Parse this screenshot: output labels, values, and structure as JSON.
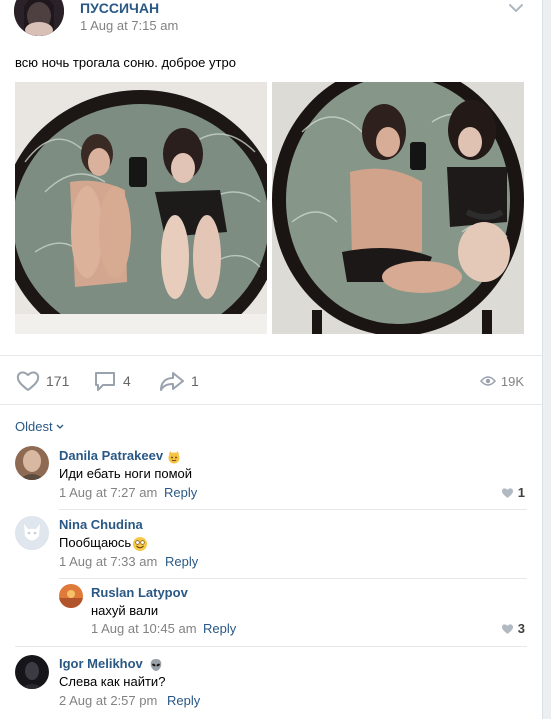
{
  "post": {
    "author": "ПУССИЧАН",
    "date": "1 Aug at 7:15 am",
    "text": "всю ночь трогала соню. доброе утро"
  },
  "actions": {
    "likes": "171",
    "comments": "4",
    "shares": "1",
    "views": "19K"
  },
  "comments_sort": "Oldest",
  "comments": [
    {
      "name": "Danila Patrakeev",
      "text": "Иди ебать ноги помой",
      "date": "1 Aug at 7:27 am",
      "reply": "Reply",
      "likes": "1",
      "badge": "cat-emoji"
    },
    {
      "name": "Nina Chudina",
      "text": "Пообщаюсь",
      "date": "1 Aug at 7:33 am",
      "reply": "Reply",
      "badge": "smile-emoji"
    },
    {
      "name": "Ruslan Latypov",
      "text": "нахуй вали",
      "date": "1 Aug at 10:45 am",
      "reply": "Reply",
      "likes": "3"
    },
    {
      "name": "Igor Melikhov",
      "text": "Слева как найти?",
      "date": "2 Aug at 2:57 pm",
      "reply": "Reply",
      "badge": "alien-emoji"
    }
  ],
  "colors": {
    "link": "#2a5885",
    "meta": "#828282",
    "divider": "#e7e8ec",
    "icon": "#99a2ad"
  }
}
